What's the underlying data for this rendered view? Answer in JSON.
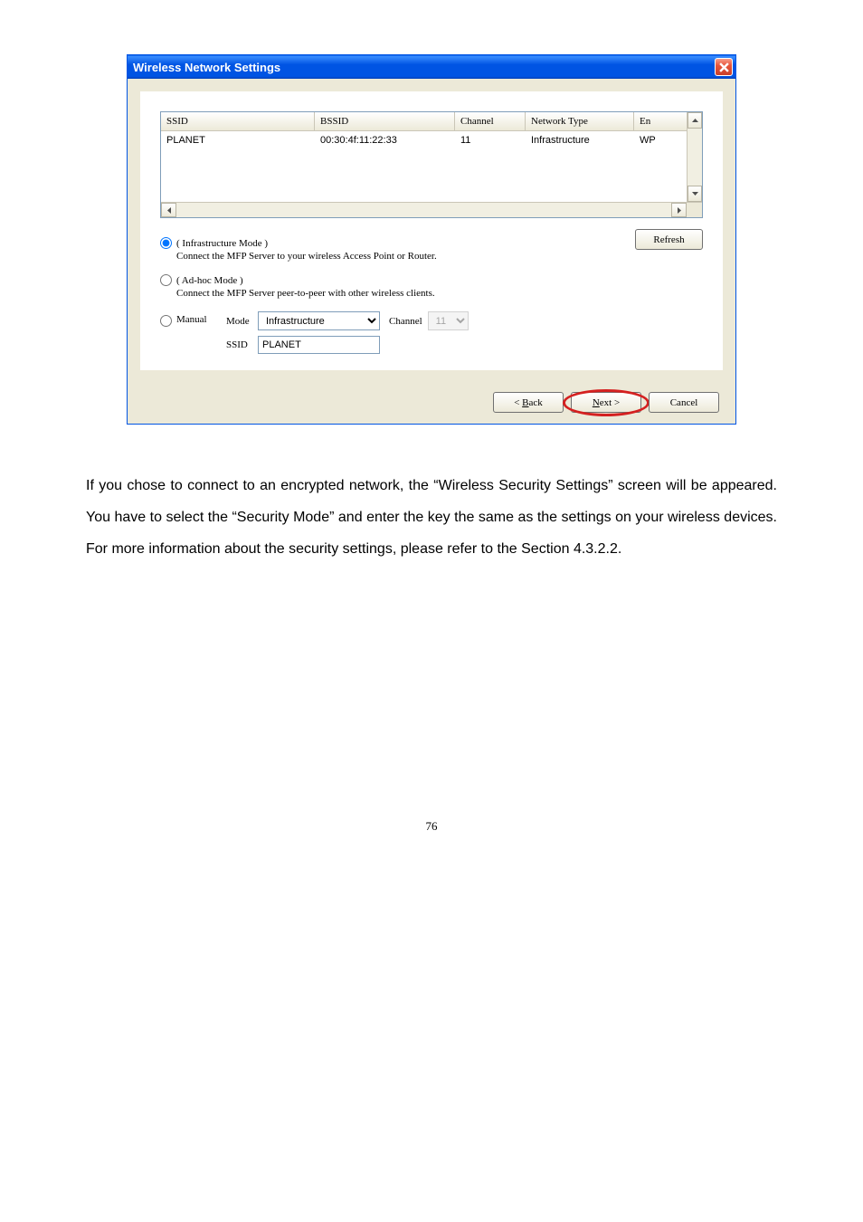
{
  "dialog": {
    "title": "Wireless Network Settings",
    "table": {
      "headers": {
        "ssid": "SSID",
        "bssid": "BSSID",
        "channel": "Channel",
        "networkType": "Network Type",
        "en": "En"
      },
      "rows": [
        {
          "ssid": "PLANET",
          "bssid": "00:30:4f:11:22:33",
          "channel": "11",
          "networkType": "Infrastructure",
          "en": "WP"
        }
      ]
    },
    "refreshBtn": "Refresh",
    "radios": {
      "infrastructure": {
        "label": "( Infrastructure Mode )",
        "desc": "Connect the MFP Server to your wireless Access Point or Router."
      },
      "adhoc": {
        "label": "( Ad-hoc Mode )",
        "desc": "Connect the MFP Server peer-to-peer with other wireless clients."
      },
      "manual": {
        "label": "Manual",
        "modeLabel": "Mode",
        "modeValue": "Infrastructure",
        "channelLabel": "Channel",
        "channelValue": "11",
        "ssidLabel": "SSID",
        "ssidValue": "PLANET"
      }
    },
    "buttons": {
      "back": "< Back",
      "next": "Next >",
      "cancel": "Cancel"
    }
  },
  "bodyText": "If you chose to connect to an encrypted network, the “Wireless Security Settings” screen will be appeared. You have to select the “Security Mode” and enter the key the same as the settings on your wireless devices. For more information about the security settings, please refer to the Section 4.3.2.2.",
  "pageNumber": "76"
}
